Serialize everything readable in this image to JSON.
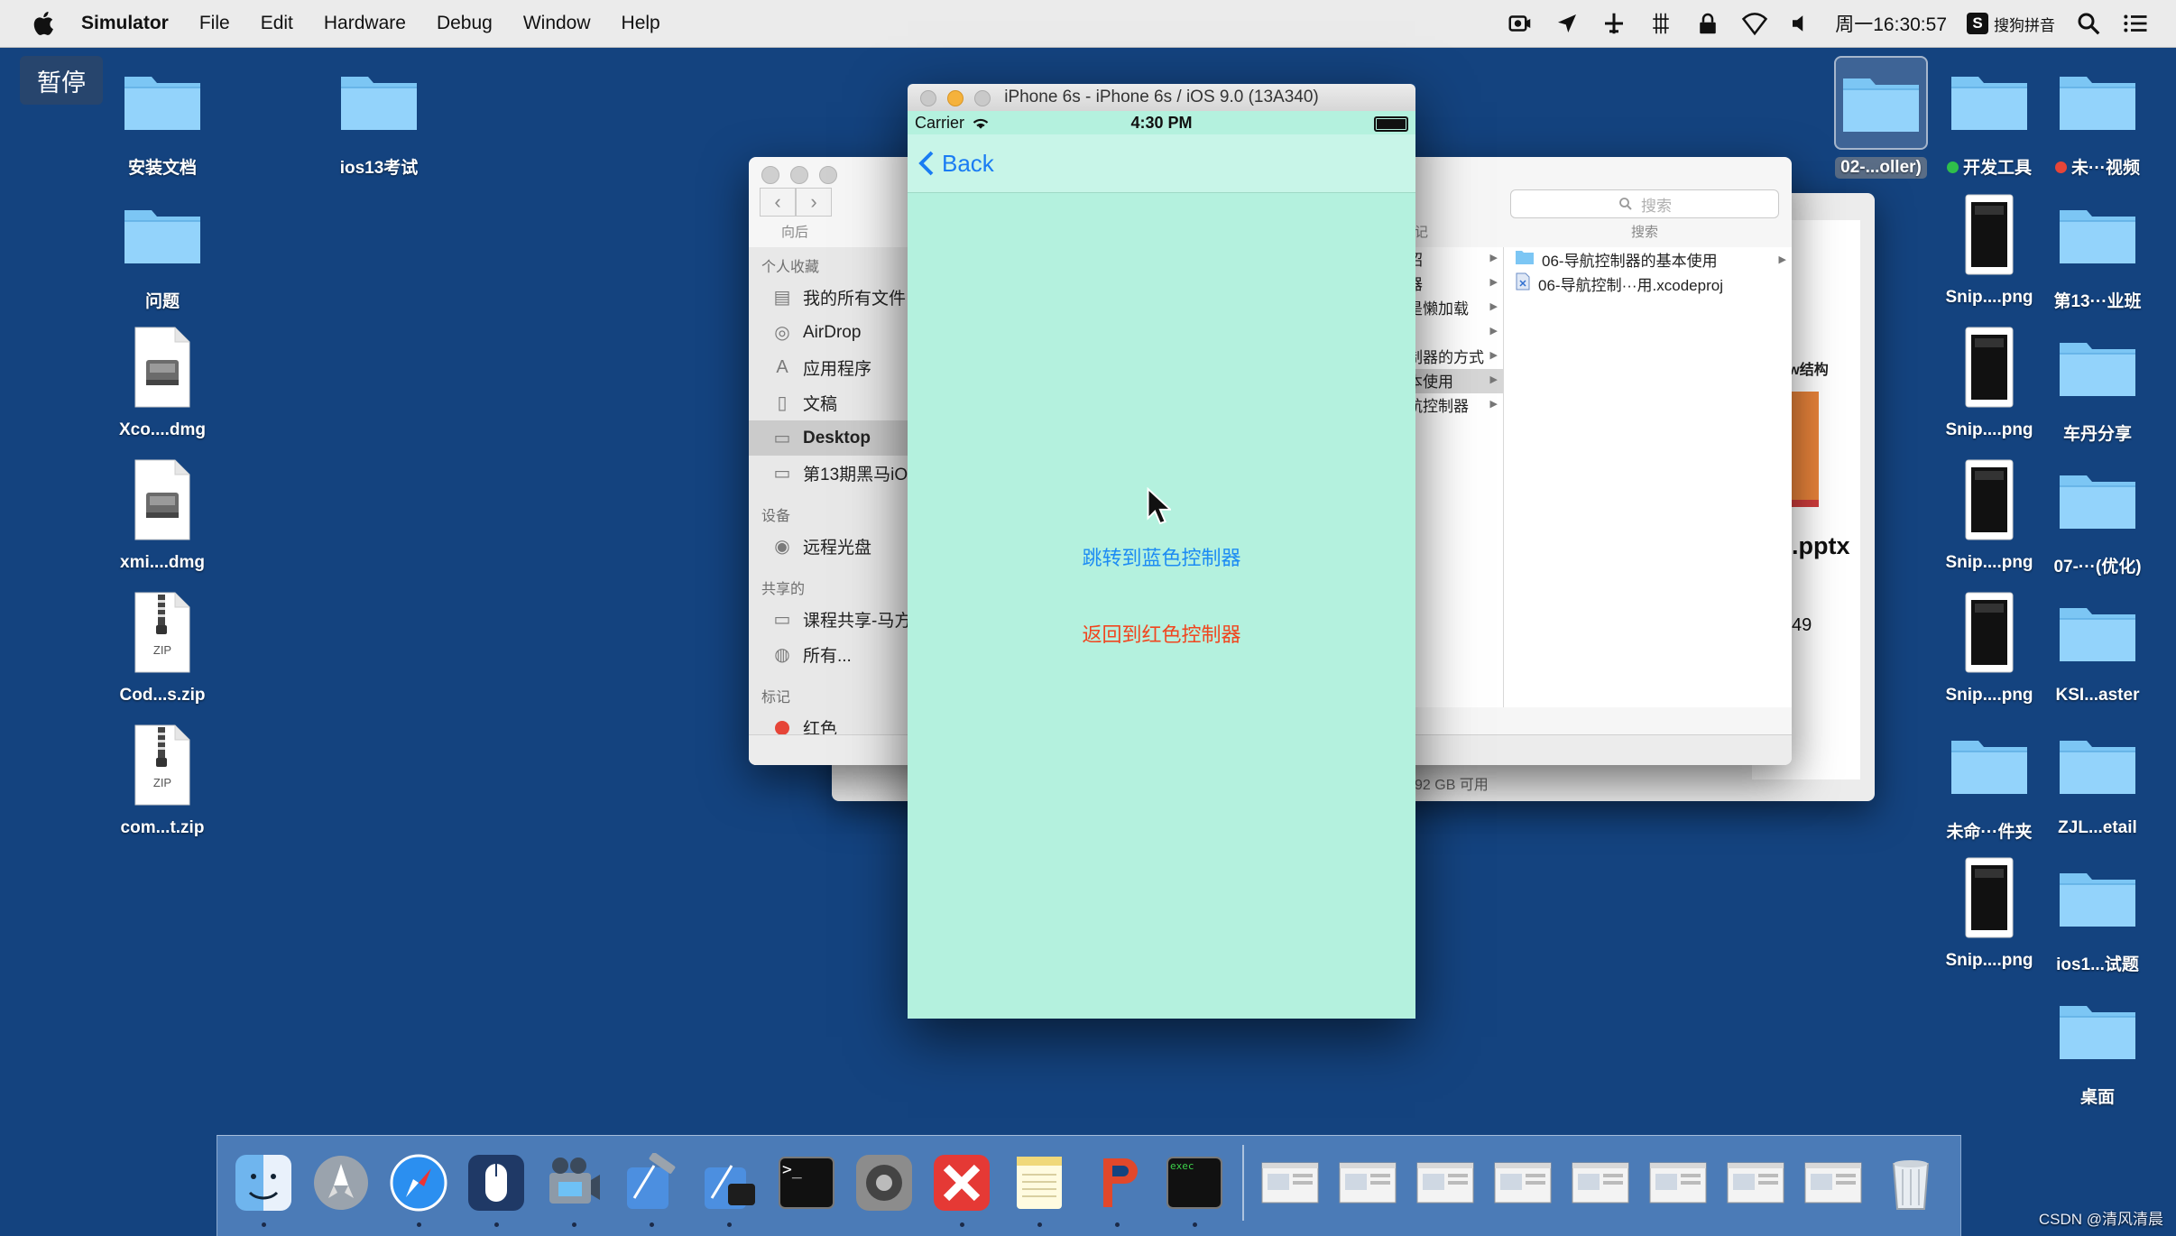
{
  "menubar": {
    "app": "Simulator",
    "menus": [
      "File",
      "Edit",
      "Hardware",
      "Debug",
      "Window",
      "Help"
    ],
    "clock": "周一16:30:57",
    "ime": "搜狗拼音",
    "ime_letter": "S"
  },
  "pause_label": "暂停",
  "desktop_left": [
    {
      "label": "安装文档",
      "icon": "folder-icon"
    },
    {
      "label": "ios13考试",
      "icon": "folder-icon"
    },
    {
      "label": "问题",
      "icon": "folder-icon"
    },
    {
      "label": "Xco....dmg",
      "icon": "disk-image-icon"
    },
    {
      "label": "xmi....dmg",
      "icon": "disk-image-icon"
    },
    {
      "label": "Cod...s.zip",
      "icon": "zip-file-icon",
      "badge": "ZIP"
    },
    {
      "label": "com...t.zip",
      "icon": "zip-file-icon",
      "badge": "ZIP"
    }
  ],
  "desktop_right": [
    {
      "label": "02-...oller)",
      "icon": "folder-icon",
      "selected": true
    },
    {
      "label": "开发工具",
      "icon": "folder-icon",
      "tag_color": "#2fbf4a"
    },
    {
      "label": "未···视频",
      "icon": "folder-icon",
      "tag_color": "#e64538"
    },
    {
      "label": "Snip....png",
      "icon": "screenshot-icon"
    },
    {
      "label": "第13···业班",
      "icon": "folder-icon"
    },
    {
      "label": "Snip....png",
      "icon": "screenshot-icon"
    },
    {
      "label": "车丹分享",
      "icon": "folder-icon"
    },
    {
      "label": "Snip....png",
      "icon": "screenshot-icon"
    },
    {
      "label": "07-···(优化)",
      "icon": "folder-icon"
    },
    {
      "label": "Snip....png",
      "icon": "screenshot-icon"
    },
    {
      "label": "KSI...aster",
      "icon": "folder-icon"
    },
    {
      "label": "未命···件夹",
      "icon": "folder-icon"
    },
    {
      "label": "ZJL...etail",
      "icon": "folder-icon"
    },
    {
      "label": "Snip....png",
      "icon": "screenshot-icon"
    },
    {
      "label": "ios1...试题",
      "icon": "folder-icon"
    },
    {
      "label": "桌面",
      "icon": "folder-icon"
    }
  ],
  "finder": {
    "nav_label": "向后",
    "search_placeholder": "搜索",
    "search_label": "搜索",
    "sections": {
      "favorites": "个人收藏",
      "devices": "设备",
      "shared": "共享的",
      "tags": "标记"
    },
    "favorites": [
      {
        "label": "我的所有文件",
        "icon": "all-files-icon"
      },
      {
        "label": "AirDrop",
        "icon": "airdrop-icon"
      },
      {
        "label": "应用程序",
        "icon": "applications-icon"
      },
      {
        "label": "文稿",
        "icon": "documents-icon"
      },
      {
        "label": "Desktop",
        "icon": "desktop-icon",
        "selected": true
      },
      {
        "label": "第13期黑马iOS",
        "icon": "folder-icon"
      }
    ],
    "devices": [
      {
        "label": "远程光盘",
        "icon": "disc-icon"
      }
    ],
    "shared": [
      {
        "label": "课程共享-马方",
        "icon": "computer-icon"
      },
      {
        "label": "所有...",
        "icon": "network-icon"
      }
    ],
    "tags": [
      {
        "label": "红色",
        "color": "#e64538"
      }
    ],
    "column1": [
      "绍",
      "器",
      "是懒加载",
      "",
      "制器的方式",
      "本使用",
      "航控制器"
    ],
    "column1_selected": 5,
    "column1_partial": "记",
    "column2": [
      {
        "label": "06-导航控制器的基本使用",
        "icon": "folder-icon"
      },
      {
        "label": "06-导航控制···用.xcodeproj",
        "icon": "xcodeproj-icon"
      }
    ],
    "free_space": "92 GB 可用",
    "preview_file": ".pptx",
    "preview_num": "49",
    "preview_text": "view结构"
  },
  "simulator": {
    "title": "iPhone 6s - iPhone 6s / iOS 9.0 (13A340)",
    "carrier": "Carrier",
    "time": "4:30 PM",
    "back_label": "Back",
    "btn_blue": "跳转到蓝色控制器",
    "btn_red": "返回到红色控制器",
    "colors": {
      "screen": "#b4f1de",
      "blue": "#1d8cf3",
      "red": "#f0461f"
    }
  },
  "dock": [
    {
      "name": "finder-dock-icon",
      "running": true
    },
    {
      "name": "launchpad-dock-icon",
      "running": false
    },
    {
      "name": "safari-dock-icon",
      "running": true
    },
    {
      "name": "mouse-dock-icon",
      "running": true
    },
    {
      "name": "imovie-dock-icon",
      "running": true
    },
    {
      "name": "xcode-dock-icon",
      "running": true
    },
    {
      "name": "instruments-dock-icon",
      "running": true
    },
    {
      "name": "terminal-dock-icon",
      "running": false
    },
    {
      "name": "system-preferences-dock-icon",
      "running": false
    },
    {
      "name": "xmind-dock-icon",
      "running": true
    },
    {
      "name": "notes-dock-icon",
      "running": true
    },
    {
      "name": "powerpoint-dock-icon",
      "running": true
    },
    {
      "name": "exec-dock-icon",
      "running": true
    },
    {
      "name": "window-thumb-1",
      "running": false
    },
    {
      "name": "window-thumb-2",
      "running": false
    },
    {
      "name": "window-thumb-3",
      "running": false
    },
    {
      "name": "window-thumb-4",
      "running": false
    },
    {
      "name": "window-thumb-5",
      "running": false
    },
    {
      "name": "window-thumb-6",
      "running": false
    },
    {
      "name": "window-thumb-7",
      "running": false
    },
    {
      "name": "window-thumb-8",
      "running": false
    },
    {
      "name": "trash-dock-icon",
      "running": false
    }
  ],
  "dock_terminal_text": ">_",
  "dock_exec_text": "exec",
  "watermark": "CSDN @清风清晨"
}
